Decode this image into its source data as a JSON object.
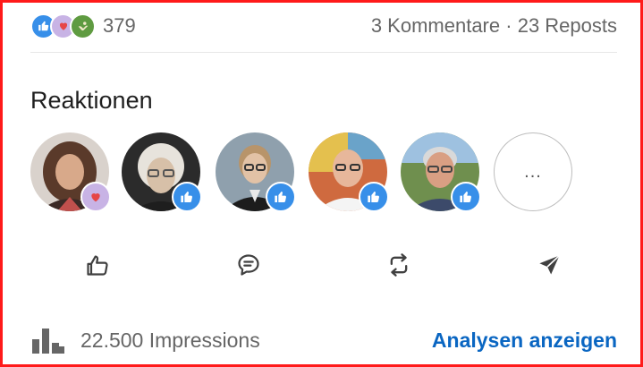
{
  "summary": {
    "reaction_count": "379",
    "comments_text": "3 Kommentare",
    "separator": "·",
    "reposts_text": "23 Reposts",
    "reaction_icons": [
      "like-icon",
      "love-icon",
      "support-icon"
    ]
  },
  "section": {
    "heading": "Reaktionen"
  },
  "reactors": [
    {
      "avatar": "avatar-woman-curly-hair",
      "badge": "love-icon"
    },
    {
      "avatar": "avatar-woman-glasses-blonde",
      "badge": "like-icon"
    },
    {
      "avatar": "avatar-woman-glasses-dark-jacket",
      "badge": "like-icon"
    },
    {
      "avatar": "avatar-man-glasses-bald",
      "badge": "like-icon"
    },
    {
      "avatar": "avatar-man-grey-hair",
      "badge": "like-icon"
    }
  ],
  "more_label": "...",
  "actions": [
    "like-outline-icon",
    "comment-icon",
    "repost-icon",
    "send-icon"
  ],
  "footer": {
    "impressions": "22.500 Impressions",
    "analytics_link": "Analysen anzeigen"
  },
  "colors": {
    "accent": "#0a66c2",
    "like_badge": "#378fe9",
    "love_badge": "#c8b3e5",
    "support_badge": "#5f9b41",
    "frame_border": "#ff1a1a"
  }
}
